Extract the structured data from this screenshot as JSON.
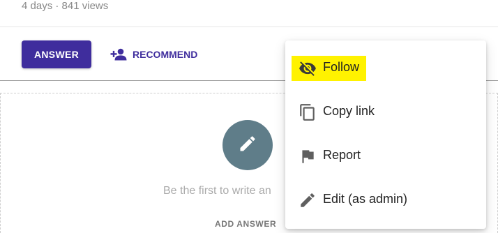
{
  "question_meta": {
    "age": "4 days",
    "separator": " · ",
    "views": "841 views"
  },
  "toolbar": {
    "answer_label": "ANSWER",
    "recommend_label": "RECOMMEND",
    "recommend_icon": "person-add-icon"
  },
  "answer_area": {
    "empty_text": "Be the first to write an",
    "add_answer_label": "ADD ANSWER",
    "pencil_icon": "pencil-icon"
  },
  "menu": {
    "items": [
      {
        "label": "Follow",
        "icon": "eye-off-icon",
        "highlighted": true
      },
      {
        "label": "Copy link",
        "icon": "copy-icon"
      },
      {
        "label": "Report",
        "icon": "flag-icon"
      },
      {
        "label": "Edit (as admin)",
        "icon": "pencil-icon"
      }
    ]
  },
  "colors": {
    "primary": "#3f2d9d",
    "fab": "#5f7d89",
    "highlight": "#fff200",
    "menu_icon": "#5f5f5f"
  }
}
